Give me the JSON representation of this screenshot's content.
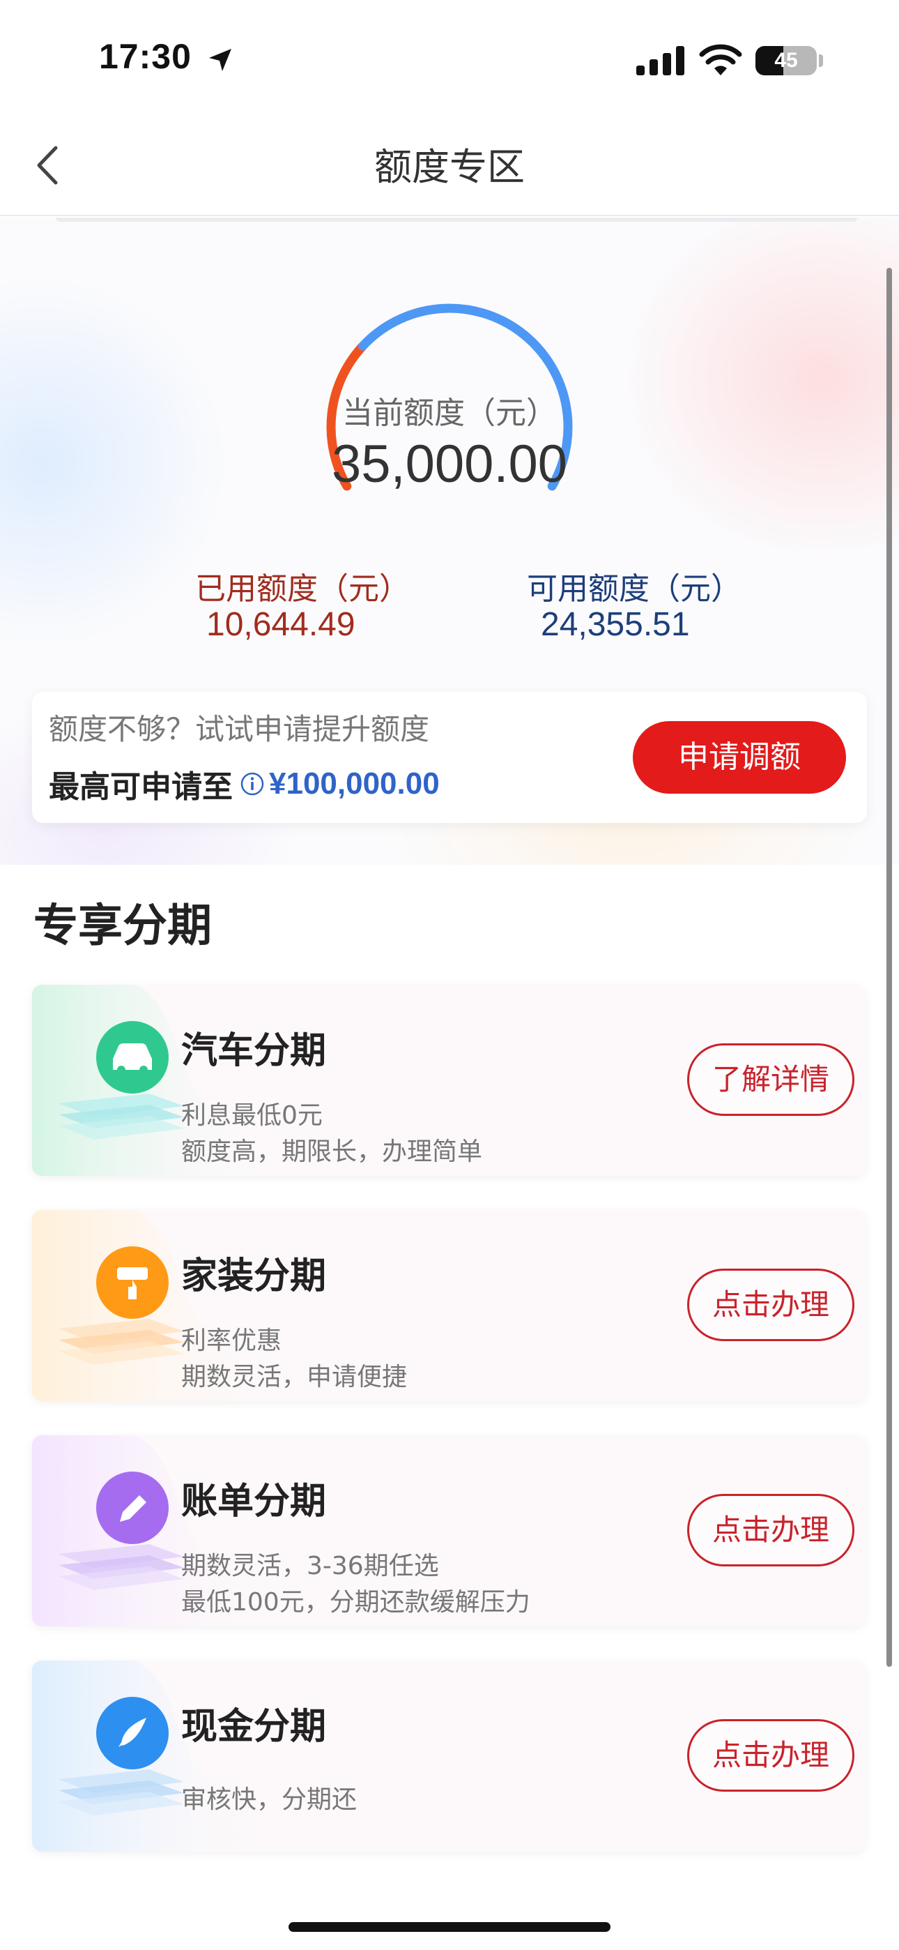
{
  "status_bar": {
    "time": "17:30",
    "battery": "45",
    "battery_level": 0.45
  },
  "nav": {
    "title": "额度专区"
  },
  "credit": {
    "current_label": "当前额度（元）",
    "current_value": "35,000.00",
    "used_label": "已用额度（元）",
    "used_value": "10,644.49",
    "available_label": "可用额度（元）",
    "available_value": "24,355.51",
    "used_ratio": 0.3041,
    "used_color": "#f0521f",
    "available_color": "#4d98f5"
  },
  "quota": {
    "hint": "额度不够？试试申请提升额度",
    "max_label": "最高可申请至",
    "max_value": "¥100,000.00",
    "button": "申请调额"
  },
  "section": {
    "title": "专享分期"
  },
  "products": [
    {
      "name": "汽车分期",
      "line1": "利息最低0元",
      "line2": "额度高，期限长，办理简单",
      "button": "了解详情",
      "icon": "car-icon",
      "color": "#2fc98f"
    },
    {
      "name": "家装分期",
      "line1": "利率优惠",
      "line2": "期数灵活，申请便捷",
      "button": "点击办理",
      "icon": "paint-roller-icon",
      "color": "#ff9a16"
    },
    {
      "name": "账单分期",
      "line1": "期数灵活，3-36期任选",
      "line2": "最低100元，分期还款缓解压力",
      "button": "点击办理",
      "icon": "pencil-icon",
      "color": "#a56cf0"
    },
    {
      "name": "现金分期",
      "line1": "审核快，分期还",
      "button": "点击办理",
      "icon": "rocket-icon",
      "color": "#2d8ff0"
    }
  ]
}
